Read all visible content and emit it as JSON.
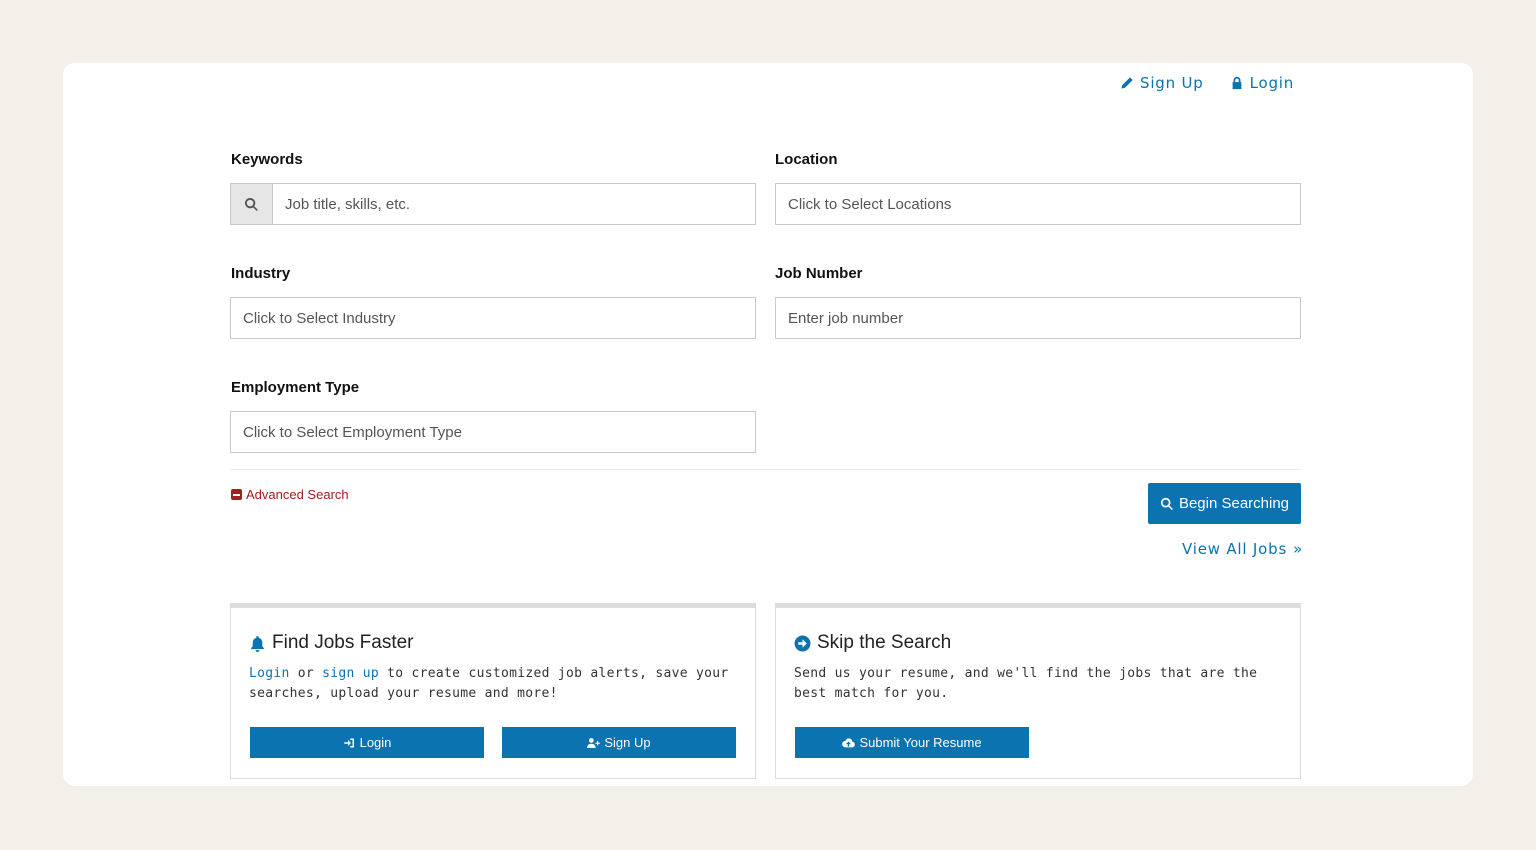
{
  "header": {
    "signup_label": "Sign Up",
    "login_label": "Login"
  },
  "form": {
    "keywords": {
      "label": "Keywords",
      "placeholder": "Job title, skills, etc."
    },
    "location": {
      "label": "Location",
      "placeholder": "Click to Select Locations"
    },
    "industry": {
      "label": "Industry",
      "placeholder": "Click to Select Industry"
    },
    "job_number": {
      "label": "Job Number",
      "placeholder": "Enter job number"
    },
    "employment_type": {
      "label": "Employment Type",
      "placeholder": "Click to Select Employment Type"
    },
    "advanced_search_label": "Advanced Search",
    "begin_button_label": "Begin Searching",
    "view_all_label": "View All Jobs",
    "view_all_arrow": "»"
  },
  "panels": {
    "find_jobs": {
      "title": "Find Jobs Faster",
      "login_link": "Login",
      "or_text": " or ",
      "signup_link": "sign up",
      "rest_text": " to create customized job alerts, save your searches, upload your resume and more!",
      "login_button": "Login",
      "signup_button": "Sign Up"
    },
    "skip_search": {
      "title": "Skip the Search",
      "text": "Send us your resume, and we'll find the jobs that are the best match for you.",
      "submit_button": "Submit Your Resume"
    }
  },
  "colors": {
    "accent": "#0a73b0",
    "danger": "#a31d1d",
    "page_background": "#f3f0ea"
  },
  "icons": [
    "pencil-icon",
    "lock-icon",
    "search-icon",
    "minus-square-icon",
    "double-chevron-right-icon",
    "bell-icon",
    "arrow-circle-right-icon",
    "sign-in-icon",
    "user-plus-icon",
    "cloud-upload-icon"
  ]
}
